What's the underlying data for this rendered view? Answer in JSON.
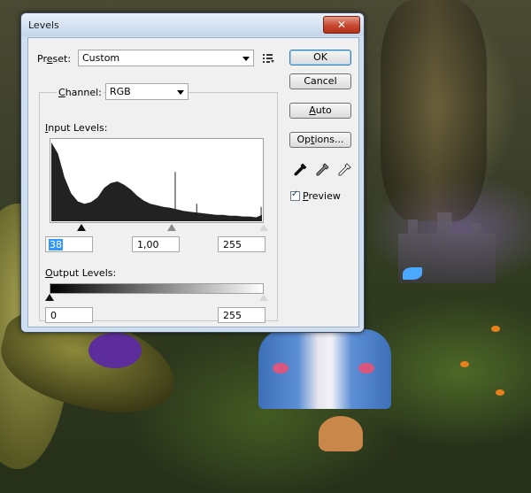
{
  "window": {
    "title": "Levels",
    "close_glyph": "✕"
  },
  "preset": {
    "label": "Preset:",
    "mnemonic_before": "Pr",
    "mnemonic": "e",
    "mnemonic_after": "set:",
    "value": "Custom"
  },
  "channel": {
    "mnemonic": "C",
    "rest": "hannel:",
    "value": "RGB"
  },
  "input_levels": {
    "mnemonic": "I",
    "rest": "nput Levels:",
    "black": "38",
    "gamma": "1,00",
    "white": "255",
    "handles_fraction": {
      "black": 0.149,
      "gamma": 0.57,
      "white": 1.0
    }
  },
  "output_levels": {
    "mnemonic": "O",
    "rest": "utput Levels:",
    "black": "0",
    "white": "255"
  },
  "buttons": {
    "ok": "OK",
    "cancel": "Cancel",
    "auto_mn": "A",
    "auto_rest": "uto",
    "options_mn": "t",
    "options_before": "Op",
    "options_after": "ions..."
  },
  "preview": {
    "mnemonic": "P",
    "rest": "review",
    "checked": true
  },
  "icons": {
    "preset_menu": "list-menu-icon",
    "eyedroppers": [
      "black-eyedropper-icon",
      "gray-eyedropper-icon",
      "white-eyedropper-icon"
    ]
  },
  "colors": {
    "title_bar": "#c3d5ea",
    "close": "#c6472f",
    "selection": "#3399ff"
  },
  "chart_data": {
    "type": "area",
    "x": [
      0,
      8,
      16,
      24,
      32,
      40,
      48,
      56,
      64,
      72,
      80,
      88,
      96,
      104,
      112,
      120,
      128,
      136,
      144,
      152,
      160,
      168,
      176,
      184,
      192,
      200,
      208,
      216,
      224,
      232,
      240,
      248,
      255
    ],
    "values": [
      99,
      85,
      55,
      35,
      25,
      22,
      24,
      30,
      42,
      48,
      50,
      46,
      40,
      32,
      26,
      22,
      20,
      18,
      17,
      15,
      13,
      12,
      11,
      10,
      9,
      8,
      8,
      7,
      7,
      6,
      6,
      5,
      8
    ],
    "spikes": [
      {
        "x": 150,
        "value": 62
      },
      {
        "x": 176,
        "value": 22
      },
      {
        "x": 254,
        "value": 18
      }
    ],
    "xlim": [
      0,
      255
    ],
    "ylim": [
      0,
      100
    ]
  }
}
